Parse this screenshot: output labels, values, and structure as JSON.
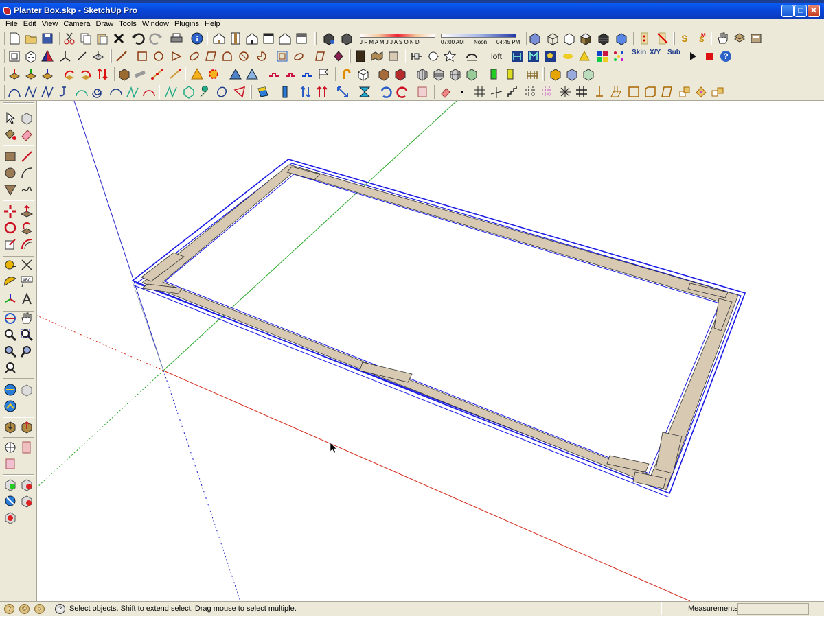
{
  "window": {
    "title": "Planter Box.skp - SketchUp Pro",
    "minimize": "_",
    "maximize": "□",
    "close": "✕"
  },
  "menu": [
    "File",
    "Edit",
    "View",
    "Camera",
    "Draw",
    "Tools",
    "Window",
    "Plugins",
    "Help"
  ],
  "shadow_settings": {
    "months": "J F M A M J J A S O N D",
    "time_start": "07:00 AM",
    "time_mid": "Noon",
    "time_end": "04:45 PM"
  },
  "toolbar_text": {
    "loft": "loft",
    "skin": "Skin",
    "xy": "X/Y",
    "sub": "Sub"
  },
  "status": {
    "text": "Select objects. Shift to extend select. Drag mouse to select multiple.",
    "measurements_label": "Measurements",
    "measurements_value": ""
  },
  "model": {
    "edge_color": "#1a1ae6",
    "board_color": "#d8c9b3",
    "axis_red": "#d42a1a",
    "axis_green": "#2aa82a",
    "axis_blue": "#2424c8"
  },
  "icons": {
    "row1": [
      "new-icon",
      "open-icon",
      "save-icon",
      "cut-icon",
      "copy-icon",
      "paste-icon",
      "erase-icon",
      "undo-icon",
      "redo-icon",
      "print-icon",
      "model-info-icon",
      "iso-view-icon",
      "top-view-icon",
      "front-view-icon",
      "right-view-icon",
      "back-view-icon",
      "left-view-icon",
      "bottom-view-icon",
      "component-icon",
      "shadow-icon",
      "xray-icon",
      "wireframe-icon",
      "hidden-line-icon",
      "shaded-icon",
      "shaded-texture-icon",
      "monochrome-icon",
      "section-plane-icon",
      "section-display-icon",
      "sandbox-icon",
      "hand-icon",
      "layers-icon"
    ],
    "left": [
      "select-icon",
      "component-icon",
      "paint-icon",
      "eraser-icon",
      "rectangle-icon",
      "line-icon",
      "circle-icon",
      "arc-icon",
      "polygon-icon",
      "freehand-icon",
      "move-icon",
      "push-pull-icon",
      "rotate-icon",
      "follow-me-icon",
      "scale-icon",
      "offset-icon",
      "tape-measure-icon",
      "dimension-icon",
      "protractor-icon",
      "text-icon",
      "axes-icon",
      "3d-text-icon",
      "orbit-icon",
      "pan-icon",
      "zoom-icon",
      "zoom-window-icon",
      "zoom-extents-icon",
      "previous-icon",
      "zoom-icon-2",
      "get-models-icon",
      "share-model-icon",
      "get-photo-icon",
      "photo-textures-icon",
      "position-camera-icon",
      "walk-icon",
      "look-around-icon",
      "section-icon",
      "add-location-icon",
      "toggle-terrain-icon",
      "preview-google-earth-icon",
      "get-models-2-icon",
      "share-component-icon"
    ]
  }
}
